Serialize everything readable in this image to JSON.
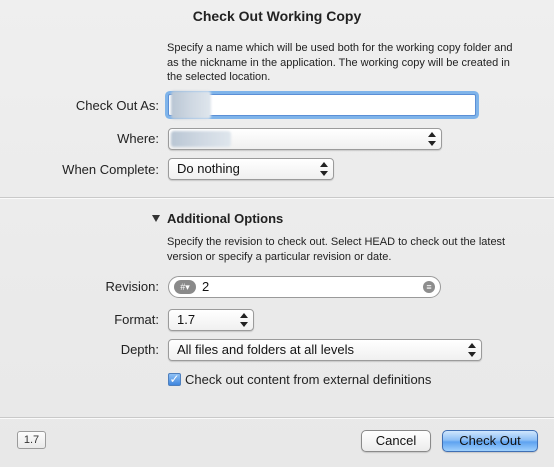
{
  "dialog": {
    "title": "Check Out Working Copy",
    "description": "Specify a name which will be used both for the working copy folder and as the nickname in the application. The working copy will be created in the selected location.",
    "check_out_as_label": "Check Out As:",
    "where_label": "Where:",
    "when_complete_label": "When Complete:",
    "when_complete_value": "Do nothing",
    "additional_options_title": "Additional Options",
    "revision_description": "Specify the revision to check out. Select HEAD to check out the latest version or specify a particular revision or date.",
    "revision_label": "Revision:",
    "revision_value": "2",
    "revision_menu_glyph": "#▾",
    "format_label": "Format:",
    "format_value": "1.7",
    "depth_label": "Depth:",
    "depth_value": "All files and folders at all levels",
    "externals_label": "Check out content from external definitions",
    "externals_checked": true,
    "cancel_label": "Cancel",
    "check_out_label": "Check Out",
    "version_badge": "1.7"
  }
}
